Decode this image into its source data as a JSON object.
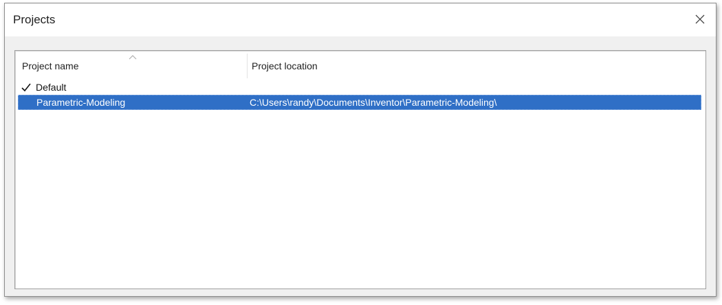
{
  "window": {
    "title": "Projects",
    "close_icon": "close-icon"
  },
  "table": {
    "columns": [
      "Project name",
      "Project location"
    ],
    "sort_indicator": "sort-up-icon",
    "rows": [
      {
        "name": "Default",
        "location": "",
        "active": true,
        "selected": false
      },
      {
        "name": "Parametric-Modeling",
        "location": "C:\\Users\\randy\\Documents\\Inventor\\Parametric-Modeling\\",
        "active": false,
        "selected": true
      }
    ]
  },
  "colors": {
    "selection": "#2f6fc6",
    "selection_text": "#ffffff",
    "dialog_bg": "#f0f0f0"
  }
}
